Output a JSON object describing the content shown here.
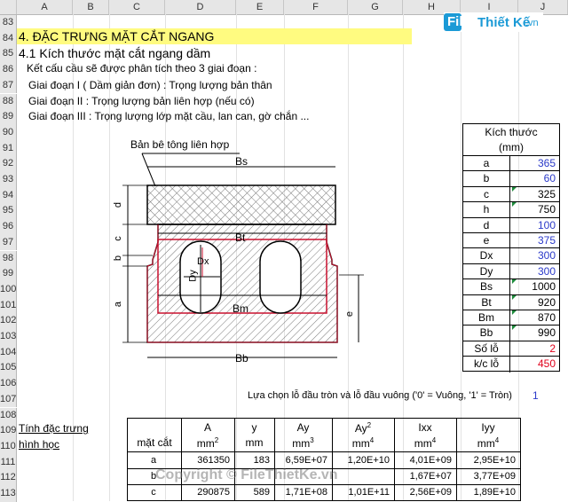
{
  "column_headers": [
    "A",
    "B",
    "C",
    "D",
    "E",
    "F",
    "G",
    "H",
    "I",
    "J"
  ],
  "row_numbers": [
    "83",
    "84",
    "85",
    "86",
    "87",
    "88",
    "89",
    "90",
    "91",
    "92",
    "93",
    "94",
    "95",
    "96",
    "97",
    "98",
    "99",
    "100",
    "101",
    "102",
    "103",
    "104",
    "105",
    "106",
    "107",
    "108",
    "109",
    "110",
    "111",
    "112",
    "113"
  ],
  "logo": {
    "text1": "File",
    "text2": "Thiết Kế",
    "text3": ".vn"
  },
  "section": {
    "title": "4. ĐẶC TRƯNG MẶT CẮT NGANG",
    "subtitle": "4.1 Kích thước mặt cắt ngang dầm",
    "intro": "Kết cấu cầu sẽ được phân tích theo 3 giai đoạn :",
    "stage1": "Giai đoạn I ( Dầm giản đơn) : Trọng lượng bản thân",
    "stage2": "Giai đoạn II   : Trọng lượng bản liên hợp (nếu có)",
    "stage3": "Giai đoạn III  : Trọng lượng lớp mặt cầu, lan can, gờ chắn ..."
  },
  "drawing": {
    "callout": "Bản bê tông liên hợp",
    "Bs": "Bs",
    "Bt": "Bt",
    "Bm": "Bm",
    "Bb": "Bb",
    "d": "d",
    "c": "c",
    "b": "b",
    "a": "a",
    "e": "e",
    "Dx": "Dx",
    "Dy": "Dy"
  },
  "dimensions": {
    "header1": "Kích thước",
    "header2": "(mm)",
    "rows": [
      {
        "label": "a",
        "value": "365",
        "color": "blue"
      },
      {
        "label": "b",
        "value": "60",
        "color": "blue"
      },
      {
        "label": "c",
        "value": "325",
        "color": "black"
      },
      {
        "label": "h",
        "value": "750",
        "color": "black"
      },
      {
        "label": "d",
        "value": "100",
        "color": "blue"
      },
      {
        "label": "e",
        "value": "375",
        "color": "blue"
      },
      {
        "label": "Dx",
        "value": "300",
        "color": "blue"
      },
      {
        "label": "Dy",
        "value": "300",
        "color": "blue"
      },
      {
        "label": "Bs",
        "value": "1000",
        "color": "black"
      },
      {
        "label": "Bt",
        "value": "920",
        "color": "black"
      },
      {
        "label": "Bm",
        "value": "870",
        "color": "black"
      },
      {
        "label": "Bb",
        "value": "990",
        "color": "black"
      },
      {
        "label": "Số lỗ",
        "value": "2",
        "color": "red"
      },
      {
        "label": "k/c lỗ",
        "value": "450",
        "color": "red"
      }
    ]
  },
  "hole_choice": {
    "label": "Lựa chọn lỗ đầu tròn và lỗ đầu vuông ('0' = Vuông, '1' = Tròn)",
    "value": "1"
  },
  "properties": {
    "label1": "Tính đặc trưng",
    "label2": "hình học",
    "headers": [
      {
        "name": "",
        "unit": "mặt cắt"
      },
      {
        "name": "A",
        "unit": "mm",
        "sup": "2"
      },
      {
        "name": "y",
        "unit": "mm",
        "sup": ""
      },
      {
        "name": "Ay",
        "unit": "mm",
        "sup": "3"
      },
      {
        "name": "Ay",
        "nsup": "2",
        "unit": "mm",
        "sup": "4"
      },
      {
        "name": "Ixx",
        "unit": "mm",
        "sup": "4"
      },
      {
        "name": "Iyy",
        "unit": "mm",
        "sup": "4"
      }
    ],
    "rows": [
      [
        "a",
        "361350",
        "183",
        "6,59E+07",
        "1,20E+10",
        "4,01E+09",
        "2,95E+10"
      ],
      [
        "b",
        "",
        "",
        "",
        "",
        "1,67E+07",
        "3,77E+09"
      ],
      [
        "c",
        "290875",
        "589",
        "1,71E+08",
        "1,01E+11",
        "2,56E+09",
        "1,89E+10"
      ]
    ]
  },
  "watermark": "Copyright © FileThietKe.vn"
}
